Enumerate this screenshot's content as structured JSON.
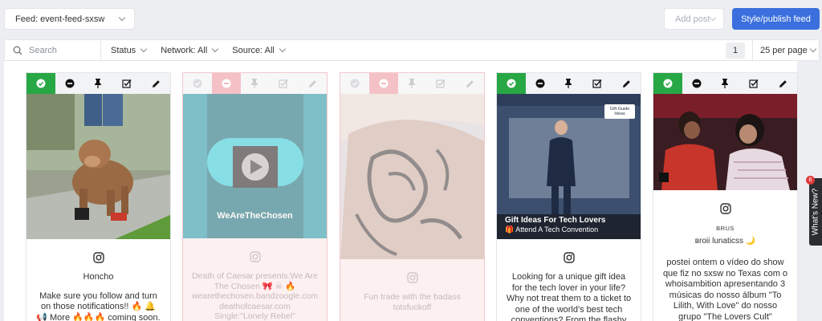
{
  "header": {
    "feed_select": "Feed: event-feed-sxsw",
    "add_post": "Add post",
    "publish": "Style/publish feed"
  },
  "filters": {
    "search_placeholder": "Search",
    "status": "Status",
    "network": "Network: All",
    "source": "Source: All",
    "page": "1",
    "per_page": "25 per page"
  },
  "cards": [
    {
      "state": "approved",
      "author": "Honcho",
      "text": "Make sure you follow and turn on those notifications!! 🔥 🔔 📢 More 🔥🔥🔥 coming soon."
    },
    {
      "state": "rejected",
      "video_caption": "WeAreTheChosen",
      "text": "Death of Caesar presents:We Are The Chosen 🎀 ☠ 🔥 wearethechosen.bandzoogle.com deathofcaesar.com Single:\"Lonely Rebel\""
    },
    {
      "state": "rejected",
      "text": "Fun trade with the badass totsfuckoff"
    },
    {
      "state": "approved",
      "overlay_title": "Gift Ideas For Tech Lovers",
      "overlay_sub": "🎁 Attend A Tech Convention",
      "logo": "Gift Guide Ideas",
      "text": "Looking for a unique gift idea for the tech lover in your life? Why not treat them to a ticket to one of the world's best tech conventions? From the flashy and futuristic to"
    },
    {
      "state": "approved",
      "author_small": "BRUS",
      "author": "вroii lunaticss 🌙",
      "text": "postei ontem o vídeo do show que fiz no sxsw no Texas com o whoisambition apresentando 3 músicas do nosso álbum \"To Lilith, With Love\" do nosso grupo \"The Lovers Cult\""
    }
  ],
  "whats_new": {
    "label": "What's New?",
    "badge": "6"
  },
  "colors": {
    "approve": "#28a745",
    "reject": "#f4c2c6",
    "primary": "#3a6fdd"
  }
}
